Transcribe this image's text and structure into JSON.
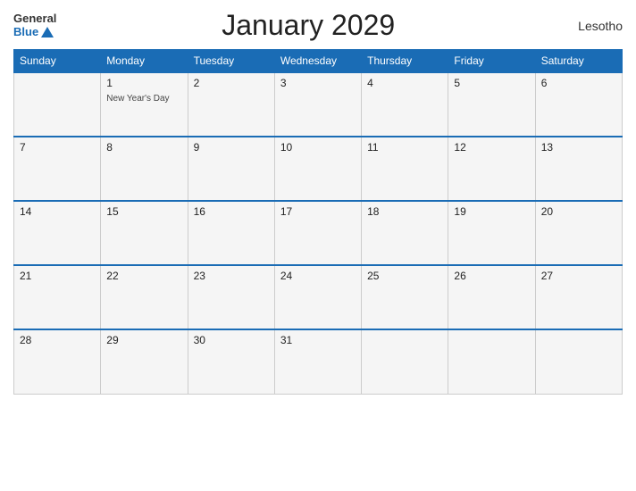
{
  "header": {
    "logo_general": "General",
    "logo_blue": "Blue",
    "title": "January 2029",
    "country": "Lesotho"
  },
  "weekdays": [
    "Sunday",
    "Monday",
    "Tuesday",
    "Wednesday",
    "Thursday",
    "Friday",
    "Saturday"
  ],
  "weeks": [
    [
      {
        "day": "",
        "empty": true
      },
      {
        "day": "1",
        "event": "New Year's Day"
      },
      {
        "day": "2",
        "event": ""
      },
      {
        "day": "3",
        "event": ""
      },
      {
        "day": "4",
        "event": ""
      },
      {
        "day": "5",
        "event": ""
      },
      {
        "day": "6",
        "event": ""
      }
    ],
    [
      {
        "day": "7",
        "event": ""
      },
      {
        "day": "8",
        "event": ""
      },
      {
        "day": "9",
        "event": ""
      },
      {
        "day": "10",
        "event": ""
      },
      {
        "day": "11",
        "event": ""
      },
      {
        "day": "12",
        "event": ""
      },
      {
        "day": "13",
        "event": ""
      }
    ],
    [
      {
        "day": "14",
        "event": ""
      },
      {
        "day": "15",
        "event": ""
      },
      {
        "day": "16",
        "event": ""
      },
      {
        "day": "17",
        "event": ""
      },
      {
        "day": "18",
        "event": ""
      },
      {
        "day": "19",
        "event": ""
      },
      {
        "day": "20",
        "event": ""
      }
    ],
    [
      {
        "day": "21",
        "event": ""
      },
      {
        "day": "22",
        "event": ""
      },
      {
        "day": "23",
        "event": ""
      },
      {
        "day": "24",
        "event": ""
      },
      {
        "day": "25",
        "event": ""
      },
      {
        "day": "26",
        "event": ""
      },
      {
        "day": "27",
        "event": ""
      }
    ],
    [
      {
        "day": "28",
        "event": ""
      },
      {
        "day": "29",
        "event": ""
      },
      {
        "day": "30",
        "event": ""
      },
      {
        "day": "31",
        "event": ""
      },
      {
        "day": "",
        "empty": true
      },
      {
        "day": "",
        "empty": true
      },
      {
        "day": "",
        "empty": true
      }
    ]
  ],
  "colors": {
    "header_bg": "#1a6cb5",
    "grid_line": "#1a6cb5",
    "cell_bg": "#f5f5f5"
  }
}
